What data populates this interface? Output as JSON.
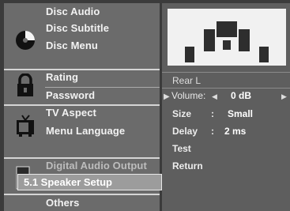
{
  "menu": {
    "disc_audio": "Disc Audio",
    "disc_subtitle": "Disc Subtitle",
    "disc_menu": "Disc Menu",
    "rating": "Rating",
    "password": "Password",
    "tv_aspect": "TV Aspect",
    "menu_language": "Menu Language",
    "digital_audio_output": "Digital Audio Output",
    "speaker_setup": "5.1 Speaker Setup",
    "others": "Others"
  },
  "speaker": {
    "channel": "Rear L",
    "volume_label": "Volume:",
    "volume_value": "0 dB",
    "size_label": "Size",
    "size_sep": ":",
    "size_value": "Small",
    "delay_label": "Delay",
    "delay_sep": ":",
    "delay_value": "2 ms",
    "test": "Test",
    "return": "Return"
  },
  "icons": {
    "disc": "disc-icon",
    "lock": "lock-icon",
    "tv": "tv-icon",
    "speaker": "speaker-icon",
    "pointer": "right-triangle-icon",
    "left_arrow": "left-arrow-icon",
    "right_arrow": "right-arrow-icon"
  },
  "colors": {
    "panel": "#6b6b6b",
    "preview": "#f1f1f1",
    "active": "#9c9c9c"
  }
}
